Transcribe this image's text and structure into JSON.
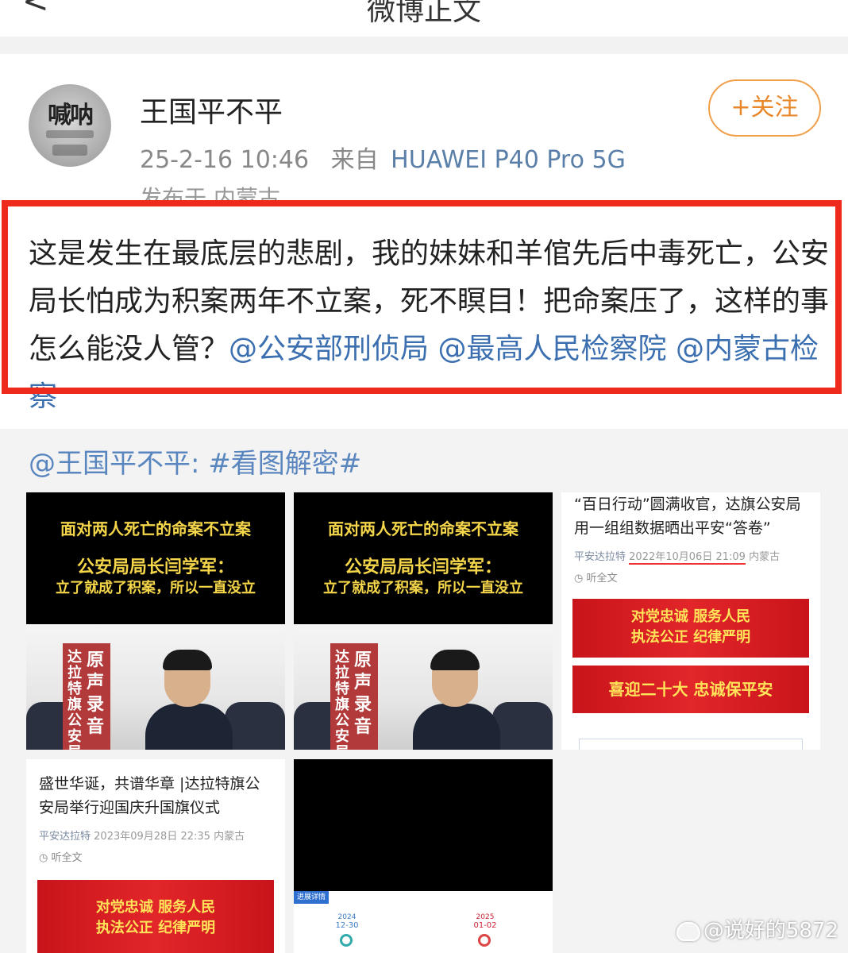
{
  "topbar": {
    "back": "<",
    "title": "微博正文"
  },
  "author": {
    "name": "王国平不平",
    "avatar_text": "喊呐",
    "time": "25-2-16 10:46",
    "from_label": "来自",
    "device": "HUAWEI P40 Pro 5G",
    "location": "发布于 内蒙古",
    "follow_label": "+关注"
  },
  "post": {
    "text": "这是发生在最底层的悲剧，我的妹妹和羊倌先后中毒死亡，公安局长怕成为积案两年不立案，死不瞑目！把命案压了，这样的事怎么能没人管？",
    "mention1": "@公安部刑侦局",
    "mention2": "@最高人民检察院",
    "mention3": "@内蒙古检察"
  },
  "repost": {
    "line": "@王国平不平: #看图解密#"
  },
  "images": {
    "video_caption_1": "面对两人死亡的命案不立案",
    "video_caption_2": "公安局局长闫学军：",
    "video_caption_3": "立了就成了积案，所以一直没立",
    "vertical_banner_small": "达拉特旗公安局局",
    "vertical_banner_large": "原声录音",
    "news1_title": "“百日行动”圆满收官，达旗公安局用一组组数据晒出平安“答卷”",
    "news1_source": "平安达拉特",
    "news1_date": "2022年10月06日 21:09",
    "news1_location": "内蒙古",
    "news1_listen": "听全文",
    "news1_banner1_line1": "对党忠诚 服务人民",
    "news1_banner1_line2": "执法公正 纪律严明",
    "news1_banner2": "喜迎二十大 忠诚保平安",
    "news2_title": "盛世华诞，共谱华章 |达拉特旗公安局举行迎国庆升国旗仪式",
    "news2_source": "平安达拉特",
    "news2_date": "2023年09月28日 22:35",
    "news2_location": "内蒙古",
    "news2_listen": "听全文",
    "news2_banner_line1": "对党忠诚 服务人民",
    "news2_banner_line2": "执法公正 纪律严明",
    "timeline_strip": "进展详情",
    "timeline_date1_year": "2024",
    "timeline_date1": "12-30",
    "timeline_date2_year": "2025",
    "timeline_date2": "01-02"
  },
  "watermark": "@说好的5872",
  "colors": {
    "highlight_box": "#ee2a1c",
    "mention": "#3b6fb0",
    "follow": "#e8882a",
    "video_caption": "#f5d64a"
  }
}
